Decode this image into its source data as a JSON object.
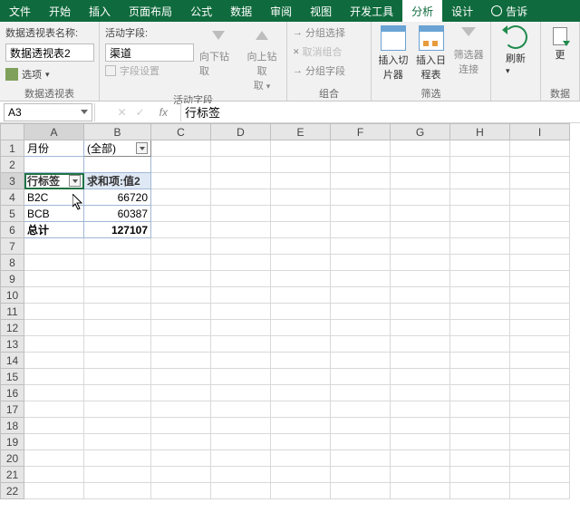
{
  "tabs": {
    "items": [
      "文件",
      "开始",
      "插入",
      "页面布局",
      "公式",
      "数据",
      "审阅",
      "视图",
      "开发工具",
      "分析",
      "设计"
    ],
    "active_index": 9,
    "tell_me": "告诉"
  },
  "ribbon": {
    "pivot": {
      "name_label": "数据透视表名称:",
      "name_value": "数据透视表2",
      "options": "选项",
      "group_label": "数据透视表"
    },
    "field": {
      "active_label": "活动字段:",
      "active_value": "渠道",
      "field_settings": "字段设置",
      "drill_down": "向下钻取",
      "drill_up": "向上钻取",
      "drill_take": "取",
      "group_label": "活动字段"
    },
    "group": {
      "sel": "分组选择",
      "ungroup": "取消组合",
      "groupfield": "分组字段",
      "group_label": "组合"
    },
    "filter": {
      "slicer": "插入切片器",
      "timeline": "插入日程表",
      "filter_conn": "筛选器连接",
      "group_label": "筛选"
    },
    "refresh": {
      "label": "刷新"
    },
    "data": {
      "change_src": "更",
      "group_label": "数据"
    }
  },
  "formula_bar": {
    "cell_ref": "A3",
    "fx": "fx",
    "value": "行标签"
  },
  "columns": [
    "A",
    "B",
    "C",
    "D",
    "E",
    "F",
    "G",
    "H",
    "I"
  ],
  "pivot": {
    "page_field": "月份",
    "page_value": "(全部)",
    "row_header": "行标签",
    "val_header": "求和项:值2",
    "rows": [
      {
        "label": "B2C",
        "value": "66720"
      },
      {
        "label": "BCB",
        "value": "60387"
      }
    ],
    "total_label": "总计",
    "total_value": "127107"
  }
}
